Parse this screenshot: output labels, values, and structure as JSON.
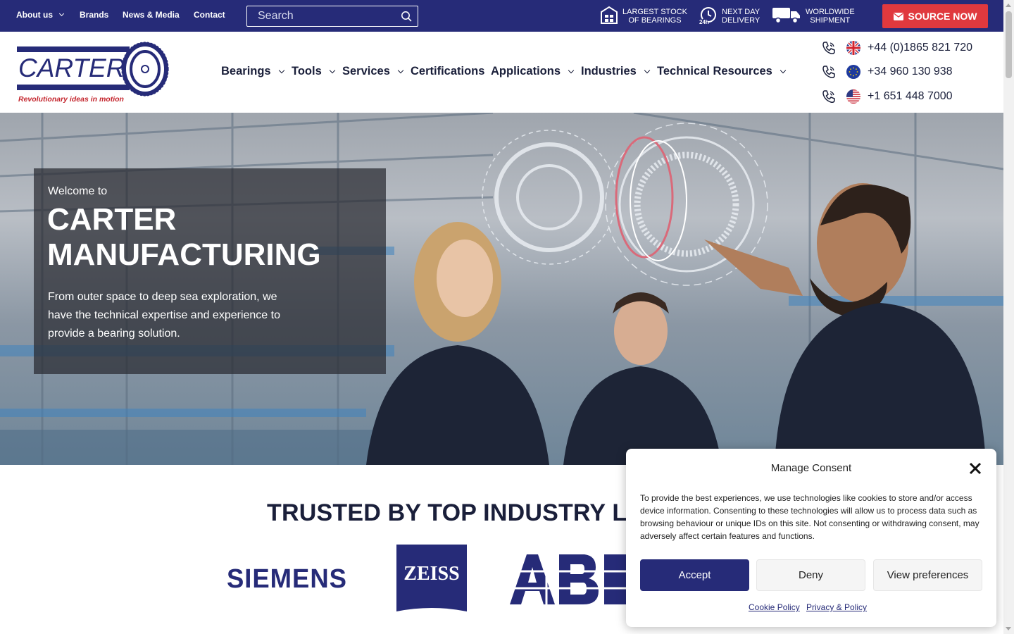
{
  "topbar": {
    "links": [
      {
        "label": "About us",
        "has_dropdown": true
      },
      {
        "label": "Brands",
        "has_dropdown": false
      },
      {
        "label": "News & Media",
        "has_dropdown": false
      },
      {
        "label": "Contact",
        "has_dropdown": false
      }
    ],
    "search": {
      "placeholder": "Search",
      "value": ""
    },
    "features": [
      {
        "icon": "warehouse-icon",
        "line1": "LARGEST STOCK",
        "line2": "OF BEARINGS"
      },
      {
        "icon": "clock-24h-icon",
        "line1": "NEXT DAY",
        "line2": "DELIVERY"
      },
      {
        "icon": "truck-icon",
        "line1": "WORLDWIDE",
        "line2": "SHIPMENT"
      }
    ],
    "source_button": "SOURCE NOW"
  },
  "brand": {
    "name": "CARTER",
    "tagline": "Revolutionary ideas in motion"
  },
  "nav": [
    {
      "label": "Bearings",
      "has_dropdown": true
    },
    {
      "label": "Tools",
      "has_dropdown": true
    },
    {
      "label": "Services",
      "has_dropdown": true
    },
    {
      "label": "Certifications",
      "has_dropdown": false
    },
    {
      "label": "Applications",
      "has_dropdown": true
    },
    {
      "label": "Industries",
      "has_dropdown": true
    },
    {
      "label": "Technical Resources",
      "has_dropdown": true
    }
  ],
  "phones": [
    {
      "flag": "uk-flag-icon",
      "number": "+44 (0)1865 821 720"
    },
    {
      "flag": "eu-flag-icon",
      "number": "+34 960 130 938"
    },
    {
      "flag": "us-flag-icon",
      "number": "+1 651 448 7000"
    }
  ],
  "hero": {
    "welcome": "Welcome to",
    "title": "CARTER MANUFACTURING",
    "body": "From outer space to deep sea exploration, we have the technical expertise and experience to provide a bearing solution."
  },
  "trusted": {
    "title": "TRUSTED BY TOP INDUSTRY L",
    "logos": [
      "SIEMENS",
      "ZEISS",
      "ABB"
    ]
  },
  "consent": {
    "title": "Manage Consent",
    "text": "To provide the best experiences, we use technologies like cookies to store and/or access device information. Consenting to these technologies will allow us to process data such as browsing behaviour or unique IDs on this site. Not consenting or withdrawing consent, may adversely affect certain features and functions.",
    "accept": "Accept",
    "deny": "Deny",
    "preferences": "View preferences",
    "links": [
      "Cookie Policy",
      "Privacy & Policy"
    ]
  },
  "colors": {
    "brand_navy": "#262b78",
    "source_red": "#e0393e",
    "tagline_red": "#c4262e",
    "text_dark": "#1a1f3a"
  }
}
